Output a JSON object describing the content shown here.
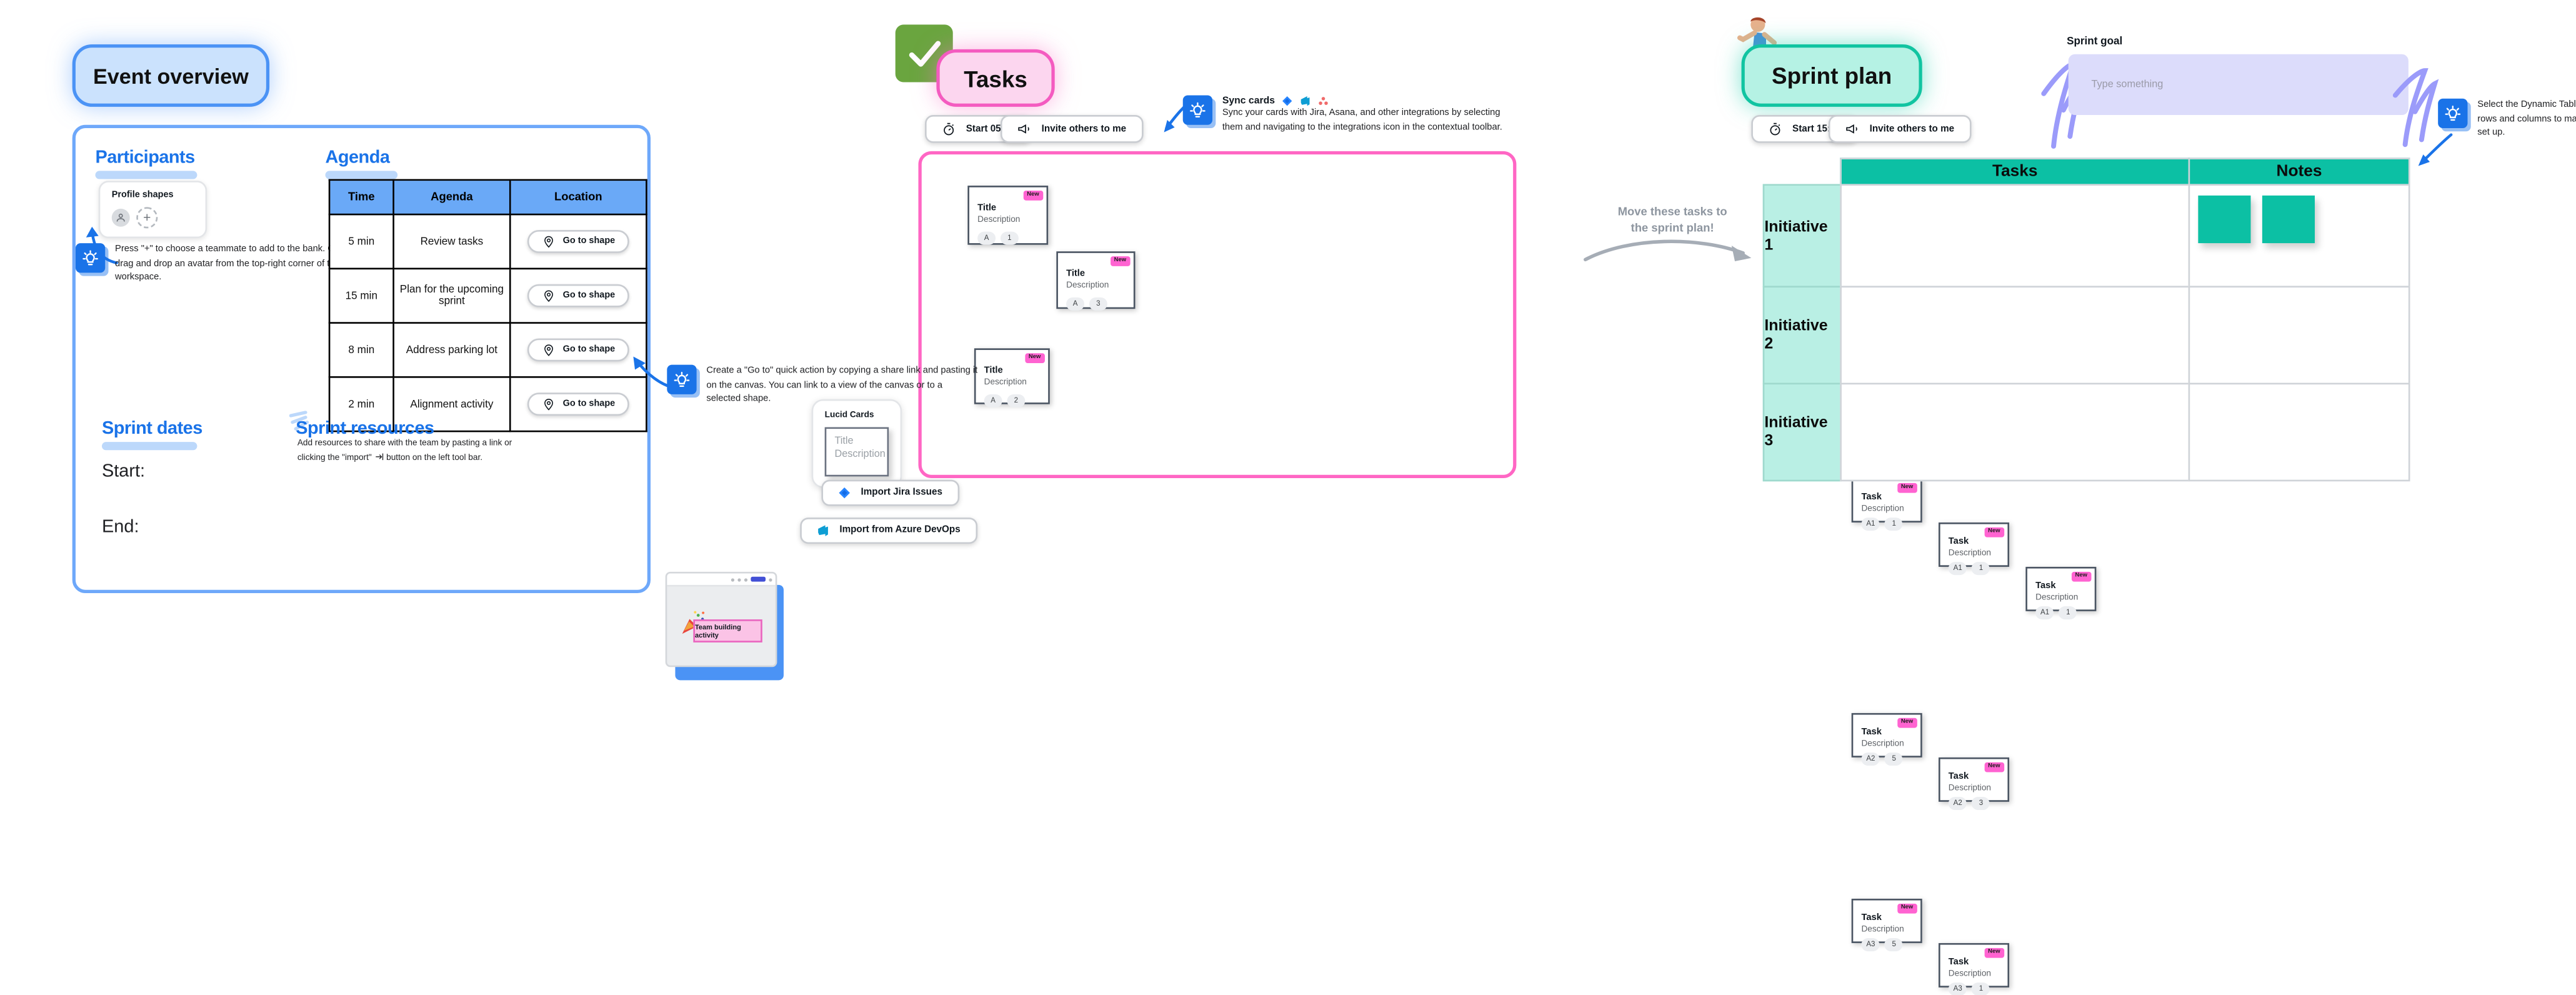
{
  "board": {
    "background": "#ffffff",
    "colors": {
      "blue_accent": "#1a73e8",
      "blue_fill": "#cbe2fd",
      "pink_accent": "#ff66c4",
      "pink_fill": "#fcd6ef",
      "teal_accent": "#11c4a1",
      "teal_fill": "#b5f2e4",
      "note_teal": "#0cc0a4",
      "badge_pink": "#ff63d1",
      "goal_fill": "#dcdcfb",
      "annotation_gray": "#8d959f"
    }
  },
  "event_overview": {
    "title": "Event overview",
    "participants": {
      "heading": "Participants",
      "profile_card_label": "Profile shapes",
      "add_label": "+",
      "tip": "Press \"+\" to choose a teammate to add to the bank. Or, drag and drop an avatar from the top-right corner of the workspace."
    },
    "agenda": {
      "heading": "Agenda",
      "columns": [
        "Time",
        "Agenda",
        "Location"
      ],
      "rows": [
        {
          "time": "5 min",
          "agenda": "Review tasks",
          "location": "Go to shape"
        },
        {
          "time": "15 min",
          "agenda": "Plan for the upcoming sprint",
          "location": "Go to shape"
        },
        {
          "time": "8 min",
          "agenda": "Address parking lot",
          "location": "Go to shape"
        },
        {
          "time": "2 min",
          "agenda": "Alignment activity",
          "location": "Go to shape"
        }
      ]
    },
    "sprint_dates": {
      "heading": "Sprint dates",
      "start_label": "Start:",
      "end_label": "End:"
    },
    "sprint_resources": {
      "heading": "Sprint resources",
      "body_before": "Add resources to share with the team by pasting a link or clicking the",
      "body_after": "button on the left tool bar.",
      "quoted": "\"import\""
    }
  },
  "tasks": {
    "title": "Tasks",
    "check_icon": "green-check-icon",
    "buttons": {
      "timer": "Start 05:00",
      "invite": "Invite others to me"
    },
    "lucid_cards": {
      "panel_label": "Lucid Cards",
      "ghost_title": "Title",
      "ghost_description": "Description",
      "import_jira": "Import Jira Issues",
      "import_azure": "Import from Azure DevOps"
    },
    "sync_tip": {
      "title": "Sync cards",
      "body": "Sync your cards with Jira, Asana, and other integrations by selecting them and navigating to the integrations icon in the contextual toolbar."
    },
    "cards": [
      {
        "badge": "New",
        "title": "Title",
        "description": "Description",
        "chips": [
          "A",
          "1"
        ]
      },
      {
        "badge": "New",
        "title": "Title",
        "description": "Description",
        "chips": [
          "A",
          "3"
        ]
      },
      {
        "badge": "New",
        "title": "Title",
        "description": "Description",
        "chips": [
          "A",
          "2"
        ]
      }
    ],
    "goto_tip": {
      "body": "Create a \"Go to\" quick action by copying a share link and pasting it on the canvas. You can link to a view of the canvas or to a selected shape.",
      "preview_note": "Team building activity"
    }
  },
  "move_annotation": "Move these tasks to\nthe sprint plan!",
  "sprint_plan": {
    "title": "Sprint plan",
    "runner_icon": "running-person-icon",
    "buttons": {
      "timer": "Start 15:00",
      "invite": "Invite others to me"
    },
    "goal": {
      "label": "Sprint goal",
      "placeholder": "Type something",
      "value": ""
    },
    "table_tip": "Select the Dynamic Table and configure the rows and columns to match your preferred set up.",
    "table": {
      "columns": [
        "Tasks",
        "Notes"
      ],
      "rows": [
        {
          "name": "Initiative 1",
          "tasks": [
            {
              "badge": "New",
              "title": "Task",
              "description": "Description",
              "chips": [
                "A1",
                "1"
              ]
            },
            {
              "badge": "New",
              "title": "Task",
              "description": "Description",
              "chips": [
                "A1",
                "1"
              ]
            },
            {
              "badge": "New",
              "title": "Task",
              "description": "Description",
              "chips": [
                "A1",
                "1"
              ]
            }
          ],
          "notes": [
            "",
            ""
          ]
        },
        {
          "name": "Initiative 2",
          "tasks": [
            {
              "badge": "New",
              "title": "Task",
              "description": "Description",
              "chips": [
                "A2",
                "5"
              ]
            },
            {
              "badge": "New",
              "title": "Task",
              "description": "Description",
              "chips": [
                "A2",
                "3"
              ]
            }
          ],
          "notes": []
        },
        {
          "name": "Initiative 3",
          "tasks": [
            {
              "badge": "New",
              "title": "Task",
              "description": "Description",
              "chips": [
                "A3",
                "5"
              ]
            },
            {
              "badge": "New",
              "title": "Task",
              "description": "Description",
              "chips": [
                "A3",
                "1"
              ]
            }
          ],
          "notes": []
        }
      ]
    }
  }
}
